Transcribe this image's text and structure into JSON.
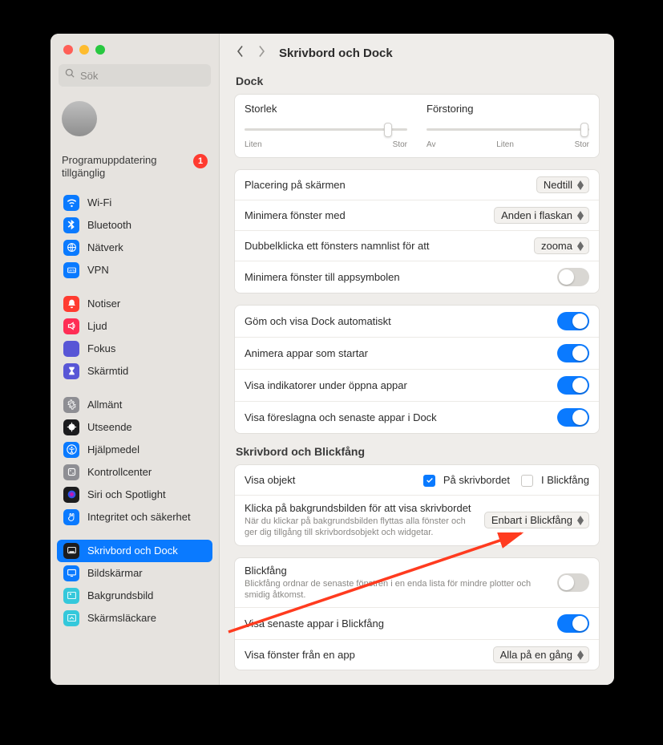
{
  "window": {
    "search_placeholder": "Sök",
    "update_text": "Programuppdatering tillgänglig",
    "update_badge": "1"
  },
  "sidebar_groups": [
    [
      {
        "label": "Wi-Fi",
        "color": "#0a7aff",
        "icon": "wifi"
      },
      {
        "label": "Bluetooth",
        "color": "#0a7aff",
        "icon": "bluetooth"
      },
      {
        "label": "Nätverk",
        "color": "#0a7aff",
        "icon": "globe"
      },
      {
        "label": "VPN",
        "color": "#0a7aff",
        "icon": "vpn"
      }
    ],
    [
      {
        "label": "Notiser",
        "color": "#ff3b30",
        "icon": "bell"
      },
      {
        "label": "Ljud",
        "color": "#ff2d55",
        "icon": "sound"
      },
      {
        "label": "Fokus",
        "color": "#5856d6",
        "icon": "moon"
      },
      {
        "label": "Skärmtid",
        "color": "#5856d6",
        "icon": "hourglass"
      }
    ],
    [
      {
        "label": "Allmänt",
        "color": "#8e8e93",
        "icon": "gear"
      },
      {
        "label": "Utseende",
        "color": "#1c1c1e",
        "icon": "appearance"
      },
      {
        "label": "Hjälpmedel",
        "color": "#0a7aff",
        "icon": "accessibility"
      },
      {
        "label": "Kontrollcenter",
        "color": "#8e8e93",
        "icon": "control"
      },
      {
        "label": "Siri och Spotlight",
        "color": "#1c1c1e",
        "icon": "siri"
      },
      {
        "label": "Integritet och säkerhet",
        "color": "#0a7aff",
        "icon": "hand"
      }
    ],
    [
      {
        "label": "Skrivbord och Dock",
        "color": "#1c1c1e",
        "icon": "dock",
        "active": true
      },
      {
        "label": "Bildskärmar",
        "color": "#0a7aff",
        "icon": "displays"
      },
      {
        "label": "Bakgrundsbild",
        "color": "#34c8db",
        "icon": "wallpaper"
      },
      {
        "label": "Skärmsläckare",
        "color": "#34c8db",
        "icon": "screensaver"
      }
    ]
  ],
  "page_title": "Skrivbord och Dock",
  "dock": {
    "heading": "Dock",
    "size_label": "Storlek",
    "size_min": "Liten",
    "size_max": "Stor",
    "mag_label": "Förstoring",
    "mag_off": "Av",
    "mag_min": "Liten",
    "mag_max": "Stor",
    "position_label": "Placering på skärmen",
    "position_value": "Nedtill",
    "minimize_label": "Minimera fönster med",
    "minimize_value": "Anden i flaskan",
    "dblclick_label": "Dubbelklicka ett fönsters namnlist för att",
    "dblclick_value": "zooma",
    "min_to_app_label": "Minimera fönster till appsymbolen",
    "autohide_label": "Göm och visa Dock automatiskt",
    "animate_label": "Animera appar som startar",
    "indicators_label": "Visa indikatorer under öppna appar",
    "suggested_label": "Visa föreslagna och senaste appar i Dock"
  },
  "stage": {
    "heading": "Skrivbord och Blickfång",
    "show_items_label": "Visa objekt",
    "on_desktop": "På skrivbordet",
    "in_stage": "I Blickfång",
    "click_bg_label": "Klicka på bakgrundsbilden för att visa skrivbordet",
    "click_bg_desc": "När du klickar på bakgrundsbilden flyttas alla fönster och ger dig tillgång till skrivbordsobjekt och widgetar.",
    "click_bg_value": "Enbart i Blickfång",
    "stage_label": "Blickfång",
    "stage_desc": "Blickfång ordnar de senaste fönstren i en enda lista för mindre plotter och smidig åtkomst.",
    "recent_label": "Visa senaste appar i Blickfång",
    "windows_from_label": "Visa fönster från en app",
    "windows_from_value": "Alla på en gång"
  }
}
